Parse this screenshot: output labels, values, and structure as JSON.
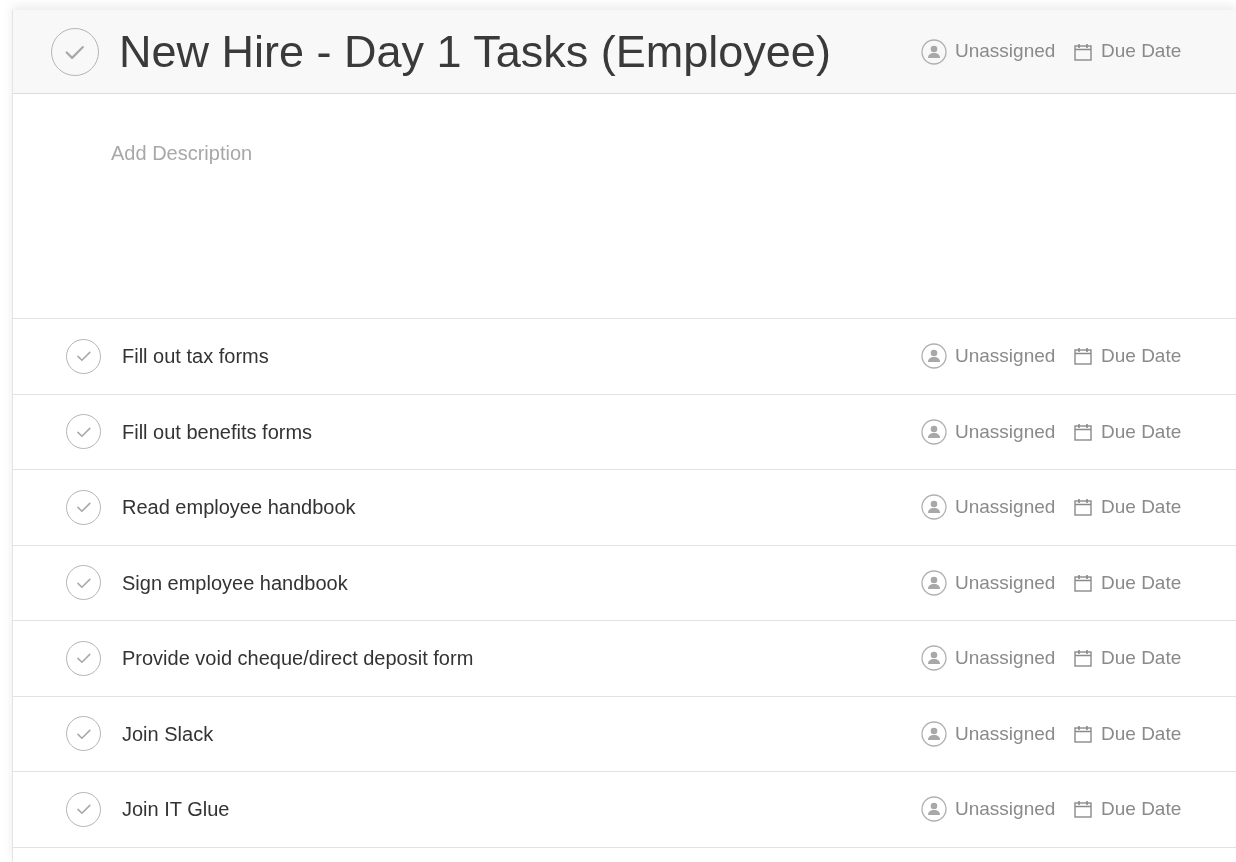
{
  "task_list": {
    "title": "New Hire - Day 1 Tasks (Employee)",
    "completed": false,
    "assignee": "Unassigned",
    "due_date": "Due Date"
  },
  "description": {
    "placeholder": "Add Description"
  },
  "tasks": [
    {
      "name": "Fill out tax forms",
      "completed": false,
      "assignee": "Unassigned",
      "due_date": "Due Date"
    },
    {
      "name": "Fill out benefits forms",
      "completed": false,
      "assignee": "Unassigned",
      "due_date": "Due Date"
    },
    {
      "name": "Read employee handbook",
      "completed": false,
      "assignee": "Unassigned",
      "due_date": "Due Date"
    },
    {
      "name": "Sign employee handbook",
      "completed": false,
      "assignee": "Unassigned",
      "due_date": "Due Date"
    },
    {
      "name": "Provide void cheque/direct deposit form",
      "completed": false,
      "assignee": "Unassigned",
      "due_date": "Due Date"
    },
    {
      "name": "Join Slack",
      "completed": false,
      "assignee": "Unassigned",
      "due_date": "Due Date"
    },
    {
      "name": "Join IT Glue",
      "completed": false,
      "assignee": "Unassigned",
      "due_date": "Due Date"
    }
  ]
}
